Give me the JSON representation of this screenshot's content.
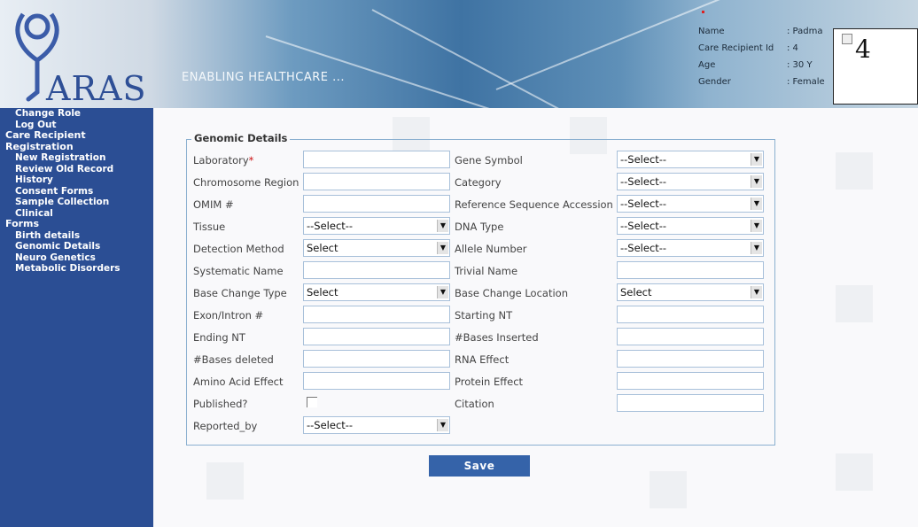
{
  "header": {
    "logo_text": "ARAS",
    "tagline": "ENABLING HEALTHCARE ...",
    "patient": {
      "name_label": "Name",
      "name_value": ": Padma",
      "id_label": "Care Recipient Id",
      "id_value": ": 4",
      "age_label": "Age",
      "age_value": ": 30 Y",
      "gender_label": "Gender",
      "gender_value": ": Female"
    },
    "photo_number": "4"
  },
  "sidebar": {
    "change_role": "Change Role",
    "log_out": "Log Out",
    "care_heading_1": "Care Recipient",
    "care_heading_2": "Registration",
    "new_registration": "New Registration",
    "review_old_record": "Review Old Record",
    "history": "History",
    "consent_forms": "Consent Forms",
    "sample_collection": "Sample Collection",
    "clinical": "Clinical",
    "forms_heading": "Forms",
    "birth_details": "Birth details",
    "genomic_details": "Genomic Details",
    "neuro_genetics": "Neuro Genetics",
    "metabolic_disorders": "Metabolic Disorders"
  },
  "form": {
    "legend": "Genomic Details",
    "required_marker": "*",
    "labels": {
      "laboratory": "Laboratory",
      "chromosome_region": "Chromosome Region",
      "omim": "OMIM #",
      "tissue": "Tissue",
      "detection_method": "Detection Method",
      "systematic_name": "Systematic Name",
      "base_change_type": "Base Change Type",
      "exon_intron": "Exon/Intron #",
      "ending_nt": "Ending NT",
      "bases_deleted": "#Bases deleted",
      "amino_acid_effect": "Amino Acid Effect",
      "published": "Published?",
      "reported_by": "Reported_by",
      "gene_symbol": "Gene Symbol",
      "category": "Category",
      "ref_seq_accession": "Reference Sequence Accession",
      "dna_type": "DNA Type",
      "allele_number": "Allele Number",
      "trivial_name": "Trivial Name",
      "base_change_location": "Base Change Location",
      "starting_nt": "Starting NT",
      "bases_inserted": "#Bases Inserted",
      "rna_effect": "RNA Effect",
      "protein_effect": "Protein Effect",
      "citation": "Citation"
    },
    "selects": {
      "tissue": "--Select--",
      "detection_method": "Select",
      "base_change_type": "Select",
      "reported_by": "--Select--",
      "gene_symbol": "--Select--",
      "category": "--Select--",
      "ref_seq_accession": "--Select--",
      "dna_type": "--Select--",
      "allele_number": "--Select--",
      "base_change_location": "Select"
    },
    "save_label": "Save"
  }
}
